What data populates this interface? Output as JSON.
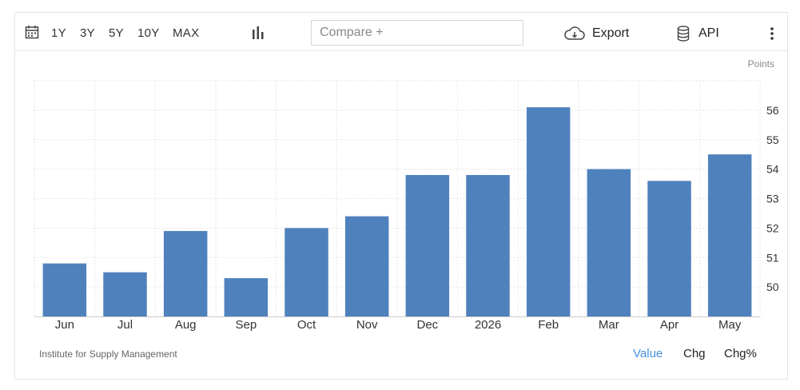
{
  "toolbar": {
    "ranges": [
      "1Y",
      "3Y",
      "5Y",
      "10Y",
      "MAX"
    ],
    "compare_placeholder": "Compare +",
    "export_label": "Export",
    "api_label": "API"
  },
  "unit_label": "Points",
  "source_label": "Institute for Supply Management",
  "modes": [
    "Value",
    "Chg",
    "Chg%"
  ],
  "active_mode": "Value",
  "colors": {
    "bar": "#4f81bd",
    "active_mode": "#4a90d9",
    "grid": "#e6e6e6"
  },
  "chart_data": {
    "type": "bar",
    "categories": [
      "Jun",
      "Jul",
      "Aug",
      "Sep",
      "Oct",
      "Nov",
      "Dec",
      "2026",
      "Feb",
      "Mar",
      "Apr",
      "May"
    ],
    "values": [
      50.8,
      50.5,
      51.9,
      50.3,
      52.0,
      52.4,
      53.8,
      53.8,
      56.1,
      54.0,
      53.6,
      54.5
    ],
    "ylim": [
      49,
      57
    ],
    "yticks": [
      50,
      51,
      52,
      53,
      54,
      55,
      56
    ],
    "grid": true
  }
}
